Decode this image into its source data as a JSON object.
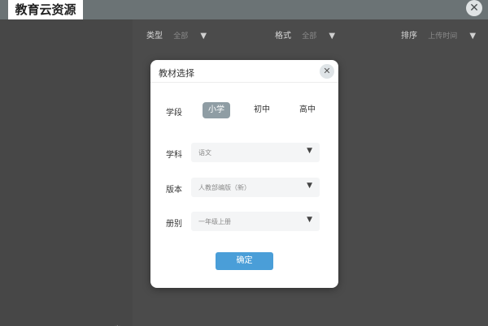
{
  "app": {
    "title": "教育云资源",
    "close_icon": "close-icon"
  },
  "filters": [
    {
      "label": "类型",
      "value": "全部"
    },
    {
      "label": "格式",
      "value": "全部"
    },
    {
      "label": "排序",
      "value": "上传时间"
    }
  ],
  "dialog": {
    "title": "教材选择",
    "stage": {
      "label": "学段",
      "options": [
        "小学",
        "初中",
        "高中"
      ],
      "selected": "小学"
    },
    "subject": {
      "label": "学科",
      "value": "语文"
    },
    "edition": {
      "label": "版本",
      "value": "人教部编版（新）"
    },
    "volume": {
      "label": "册别",
      "value": "一年级上册"
    },
    "confirm_label": "确定"
  },
  "colors": {
    "accent": "#4a9ed8",
    "selected_chip": "#8f9da4",
    "overlay": "#4a4a4a"
  }
}
